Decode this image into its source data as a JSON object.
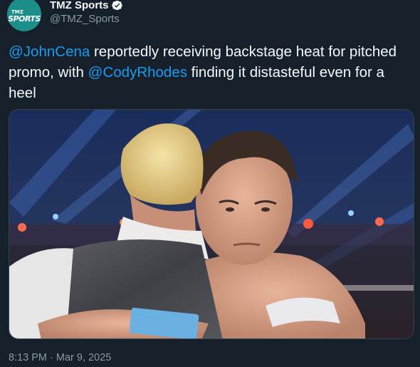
{
  "account": {
    "display_name": "TMZ Sports",
    "handle": "@TMZ_Sports",
    "verified": true,
    "avatar": {
      "line1": "TMZ",
      "line2": "SPORTS",
      "bg_color": "#1d8f8a"
    }
  },
  "tweet": {
    "segments": [
      {
        "text": "@JohnCena",
        "type": "mention"
      },
      {
        "text": " reportedly receiving backstage heat for pitched promo, with ",
        "type": "text"
      },
      {
        "text": "@CodyRhodes",
        "type": "mention"
      },
      {
        "text": " finding it distasteful even for a heel",
        "type": "text"
      }
    ],
    "timestamp": "8:13 PM · Mar 9, 2025"
  },
  "media": {
    "icon": "photo-wrestlers-embrace"
  },
  "colors": {
    "background": "#15202b",
    "text": "#f7f9f9",
    "secondary": "#8b98a5",
    "link": "#1d9bf0",
    "verified": "#f7f9f9"
  }
}
